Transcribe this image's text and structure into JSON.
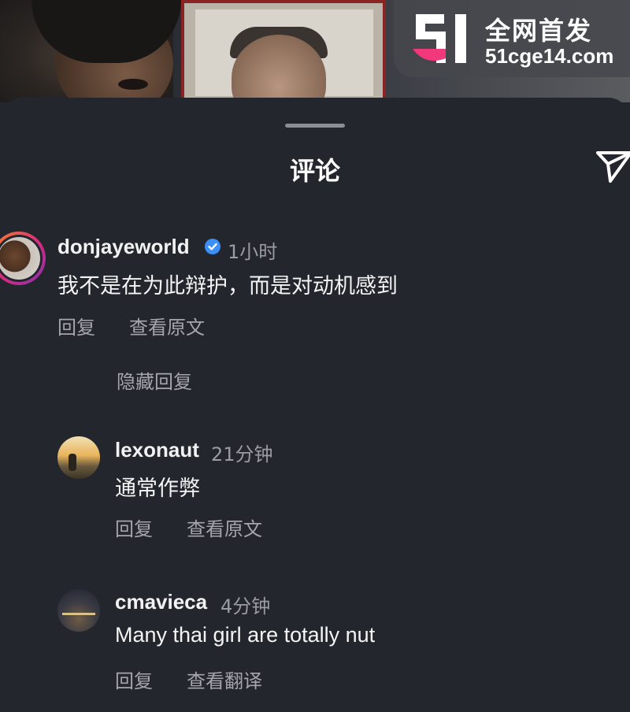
{
  "watermark": {
    "title": "全网首发",
    "url": "51cge14.com"
  },
  "sheet": {
    "title": "评论"
  },
  "comments": [
    {
      "username": "donjayeworld",
      "time": "1小时",
      "text": "我不是在为此辩护，而是对动机感到",
      "actions": [
        "回复",
        "查看原文"
      ],
      "hide_replies": "隐藏回复"
    },
    {
      "username": "lexonaut",
      "time": "21分钟",
      "text": "通常作弊",
      "actions": [
        "回复",
        "查看原文"
      ]
    },
    {
      "username": "cmavieca",
      "time": "4分钟",
      "text": "Many thai girl are totally nut",
      "actions": [
        "回复",
        "查看翻译"
      ]
    }
  ],
  "icons": {
    "share": "send-icon",
    "verified": "verified-badge-icon"
  },
  "colors": {
    "background": "#23262c",
    "verified": "#3b8ff7",
    "ring_gradient": [
      "#f58529",
      "#dd2a7b",
      "#8134af"
    ]
  }
}
